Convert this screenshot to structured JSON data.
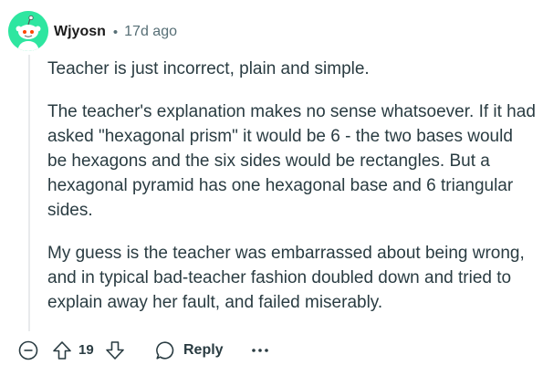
{
  "comment": {
    "username": "Wjyosn",
    "separator": "•",
    "timestamp": "17d ago",
    "avatar_color": "#2ee6a0",
    "paragraphs": [
      "Teacher is just incorrect, plain and simple.",
      "The teacher's explanation makes no sense whatsoever. If it had asked \"hexagonal prism\" it would be 6 - the two bases would be hexagons and the six sides would be rectangles. But a hexagonal pyramid has one hexagonal base and 6 triangular sides.",
      "My guess is the teacher was embarrassed about being wrong, and in typical bad-teacher fashion doubled down and tried to explain away her fault, and failed miserably."
    ]
  },
  "actions": {
    "collapse_icon": "minus-circle-icon",
    "upvote_icon": "upvote-arrow-icon",
    "vote_count": "19",
    "downvote_icon": "downvote-arrow-icon",
    "reply_icon": "speech-bubble-icon",
    "reply_label": "Reply",
    "more_icon": "ellipsis-icon",
    "more_label": "•••"
  }
}
